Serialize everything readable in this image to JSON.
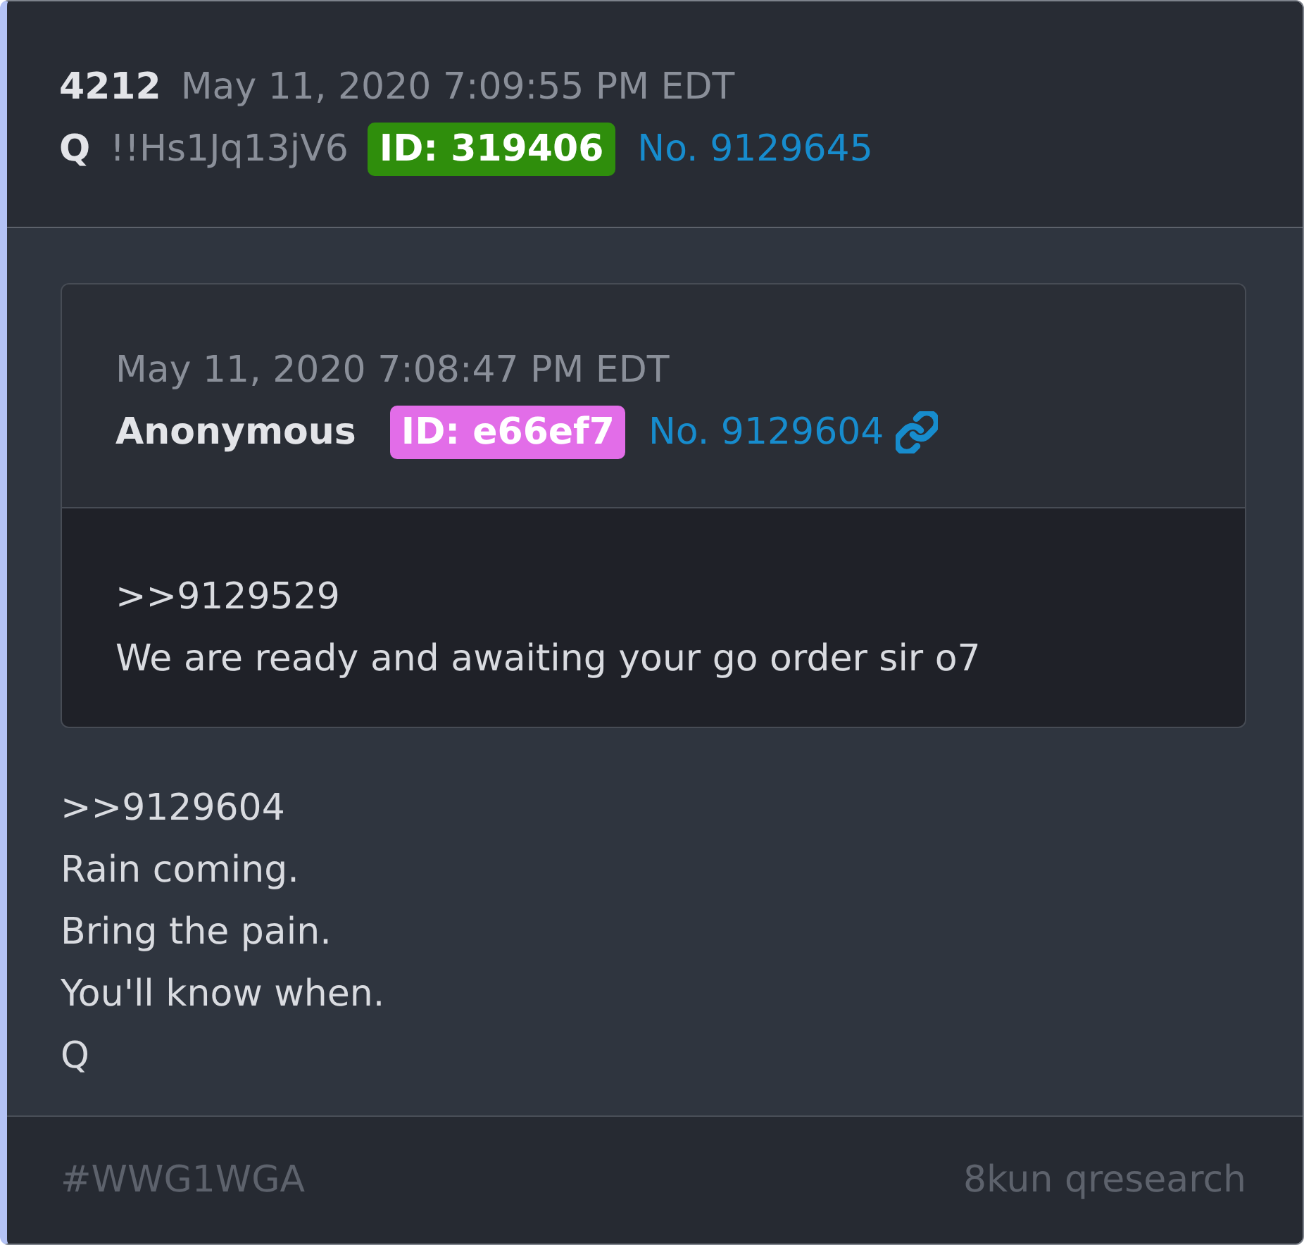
{
  "post": {
    "number": "4212",
    "timestamp": "May 11, 2020 7:09:55 PM EDT",
    "author": "Q",
    "tripcode": "!!Hs1Jq13jV6",
    "id_badge": {
      "text": "ID: 319406",
      "color": "#2f8e0c"
    },
    "post_no": "No. 9129645"
  },
  "quoted_post": {
    "timestamp": "May 11, 2020 7:08:47 PM EDT",
    "author": "Anonymous",
    "id_badge": {
      "text": "ID: e66ef7",
      "color": "#e26de8"
    },
    "post_no": "No. 9129604",
    "lines": [
      ">>9129529",
      "We are ready and awaiting your go order sir o7"
    ]
  },
  "body_lines": [
    ">>9129604",
    "Rain coming.",
    "Bring the pain.",
    "You'll know when.",
    "Q"
  ],
  "footer": {
    "hashtag": "#WWG1WGA",
    "source": "8kun qresearch"
  }
}
